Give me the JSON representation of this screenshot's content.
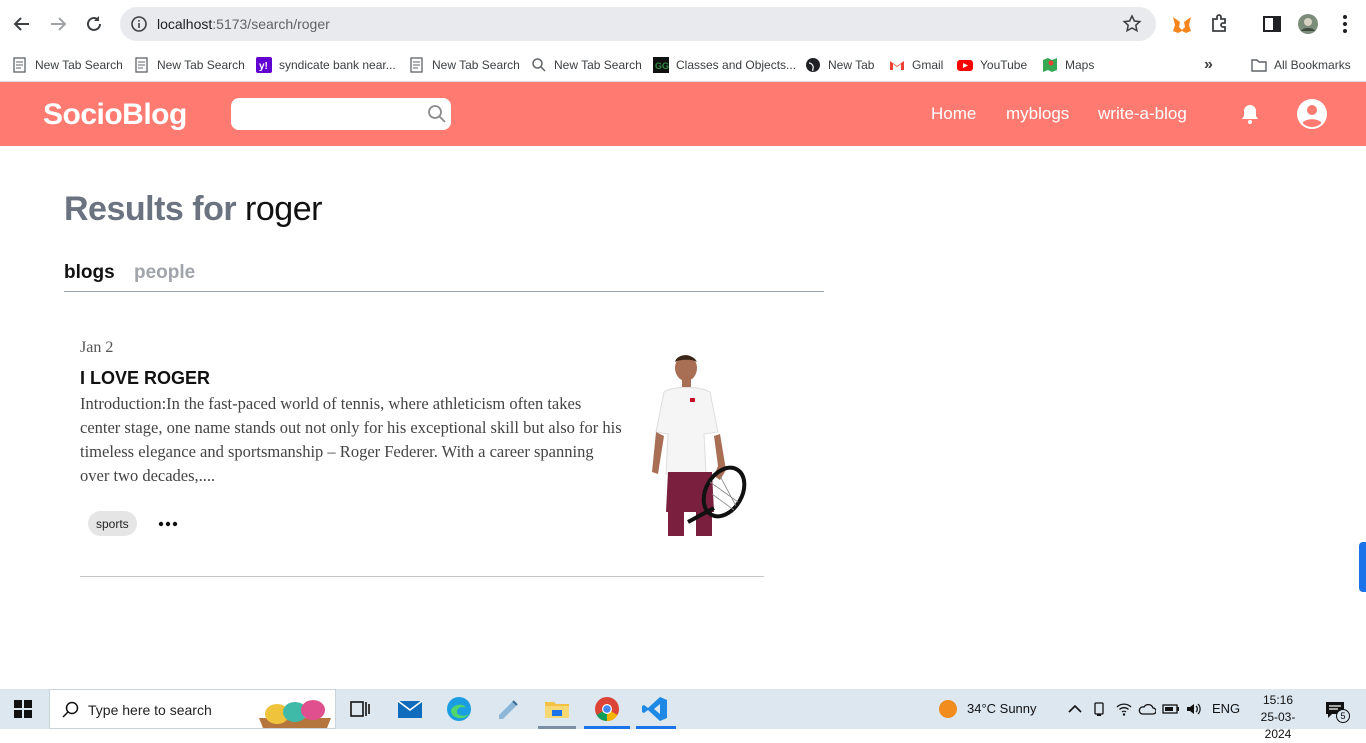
{
  "browser": {
    "url_host": "localhost",
    "url_path": ":5173/search/roger",
    "bookmarks": [
      {
        "label": "New Tab Search",
        "icon": "page-icon"
      },
      {
        "label": "New Tab Search",
        "icon": "page-icon"
      },
      {
        "label": "syndicate bank near...",
        "icon": "yahoo-icon"
      },
      {
        "label": "New Tab Search",
        "icon": "page-icon"
      },
      {
        "label": "New Tab Search",
        "icon": "search-icon"
      },
      {
        "label": "Classes and Objects...",
        "icon": "gfg-icon"
      },
      {
        "label": "New Tab",
        "icon": "globe-icon"
      },
      {
        "label": "Gmail",
        "icon": "gmail-icon"
      },
      {
        "label": "YouTube",
        "icon": "youtube-icon"
      },
      {
        "label": "Maps",
        "icon": "maps-icon"
      }
    ],
    "more_bookmarks": "»",
    "all_bookmarks": "All Bookmarks"
  },
  "app": {
    "logo": "SocioBlog",
    "search_placeholder": "",
    "nav": [
      "Home",
      "myblogs",
      "write-a-blog"
    ],
    "accent": "#ff7a70"
  },
  "results": {
    "prefix": "Results for ",
    "query": "roger",
    "tabs": [
      "blogs",
      "people"
    ],
    "active_tab": "blogs"
  },
  "blogs": [
    {
      "date": "Jan 2",
      "title": "I LOVE ROGER",
      "excerpt": "Introduction:In the fast-paced world of tennis, where athleticism often takes center stage, one name stands out not only for his exceptional skill but also for his timeless elegance and sportsmanship – Roger Federer. With a career spanning over two decades,....",
      "tag": "sports"
    }
  ],
  "taskbar": {
    "search_placeholder": "Type here to search",
    "weather": "34°C  Sunny",
    "lang": "ENG",
    "time": "15:16",
    "date": "25-03-2024",
    "notifications": "5"
  }
}
